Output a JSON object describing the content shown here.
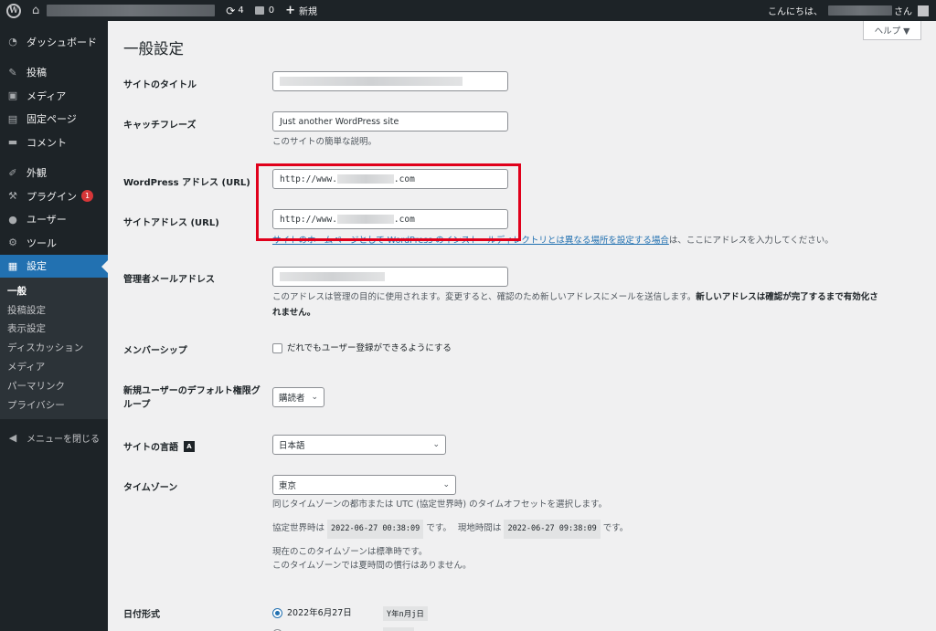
{
  "adminbar": {
    "updates_count": "4",
    "comments_count": "0",
    "new_label": "新規",
    "greeting_prefix": "こんにちは、",
    "greeting_suffix": "さん"
  },
  "sidebar": {
    "items": [
      {
        "label": "ダッシュボード",
        "icon": "dashboard-icon"
      },
      {
        "label": "投稿",
        "icon": "pin-icon"
      },
      {
        "label": "メディア",
        "icon": "media-icon"
      },
      {
        "label": "固定ページ",
        "icon": "page-icon"
      },
      {
        "label": "コメント",
        "icon": "comment-icon"
      },
      {
        "label": "外観",
        "icon": "brush-icon"
      },
      {
        "label": "プラグイン",
        "icon": "plugin-icon",
        "badge": "1"
      },
      {
        "label": "ユーザー",
        "icon": "user-icon"
      },
      {
        "label": "ツール",
        "icon": "wrench-icon"
      },
      {
        "label": "設定",
        "icon": "settings-icon"
      }
    ],
    "submenu": [
      "一般",
      "投稿設定",
      "表示設定",
      "ディスカッション",
      "メディア",
      "パーマリンク",
      "プライバシー"
    ],
    "collapse_label": "メニューを閉じる"
  },
  "main": {
    "help_label": "ヘルプ ▼",
    "page_title": "一般設定",
    "site_title_label": "サイトのタイトル",
    "tagline_label": "キャッチフレーズ",
    "tagline_value": "Just another WordPress site",
    "tagline_desc": "このサイトの簡単な説明。",
    "wp_address_label": "WordPress アドレス (URL)",
    "site_address_label": "サイトアドレス (URL)",
    "url_prefix": "http://www.",
    "url_suffix": ".com",
    "site_address_desc_link": "サイトのホームページとして WordPress のインストールディレクトリとは異なる場所を設定する場合",
    "site_address_desc_rest": "は、ここにアドレスを入力してください。",
    "admin_email_label": "管理者メールアドレス",
    "admin_email_desc": "このアドレスは管理の目的に使用されます。変更すると、確認のため新しいアドレスにメールを送信します。",
    "admin_email_desc_bold": "新しいアドレスは確認が完了するまで有効化されません。",
    "membership_label": "メンバーシップ",
    "membership_checkbox": "だれでもユーザー登録ができるようにする",
    "default_role_label": "新規ユーザーのデフォルト権限グループ",
    "default_role_value": "購読者",
    "site_language_label": "サイトの言語",
    "site_language_value": "日本語",
    "timezone_label": "タイムゾーン",
    "timezone_value": "東京",
    "timezone_desc": "同じタイムゾーンの都市または UTC (協定世界時) のタイムオフセットを選択します。",
    "utc_label": "協定世界時は",
    "utc_value": "2022-06-27 00:38:09",
    "utc_after": "です。",
    "local_label": "現地時間は",
    "local_value": "2022-06-27 09:38:09",
    "local_after": "です。",
    "std_time_desc": "現在のこのタイムゾーンは標準時です。",
    "dst_desc": "このタイムゾーンでは夏時間の慣行はありません。",
    "date_format_label": "日付形式",
    "date_format_option": "2022年6月27日",
    "date_format_code": "Y年n月j日"
  }
}
